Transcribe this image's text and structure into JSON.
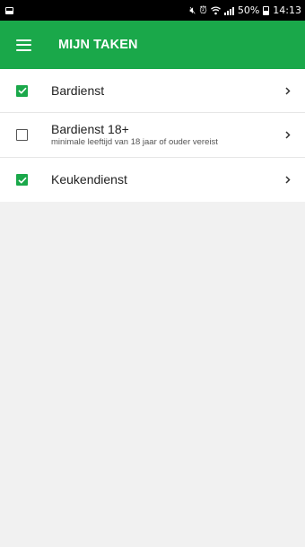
{
  "status_bar": {
    "battery_percent": "50%",
    "time": "14:13",
    "icons": [
      "notification-icon",
      "mute-icon",
      "alarm-icon",
      "wifi-icon",
      "signal-icon",
      "battery-icon"
    ]
  },
  "app_bar": {
    "title": "MIJN TAKEN",
    "background_color": "#1aa84a"
  },
  "tasks": [
    {
      "title": "Bardienst",
      "subtitle": "",
      "checked": true
    },
    {
      "title": "Bardienst 18+",
      "subtitle": "minimale leeftijd van 18 jaar of ouder vereist",
      "checked": false
    },
    {
      "title": "Keukendienst",
      "subtitle": "",
      "checked": true
    }
  ]
}
